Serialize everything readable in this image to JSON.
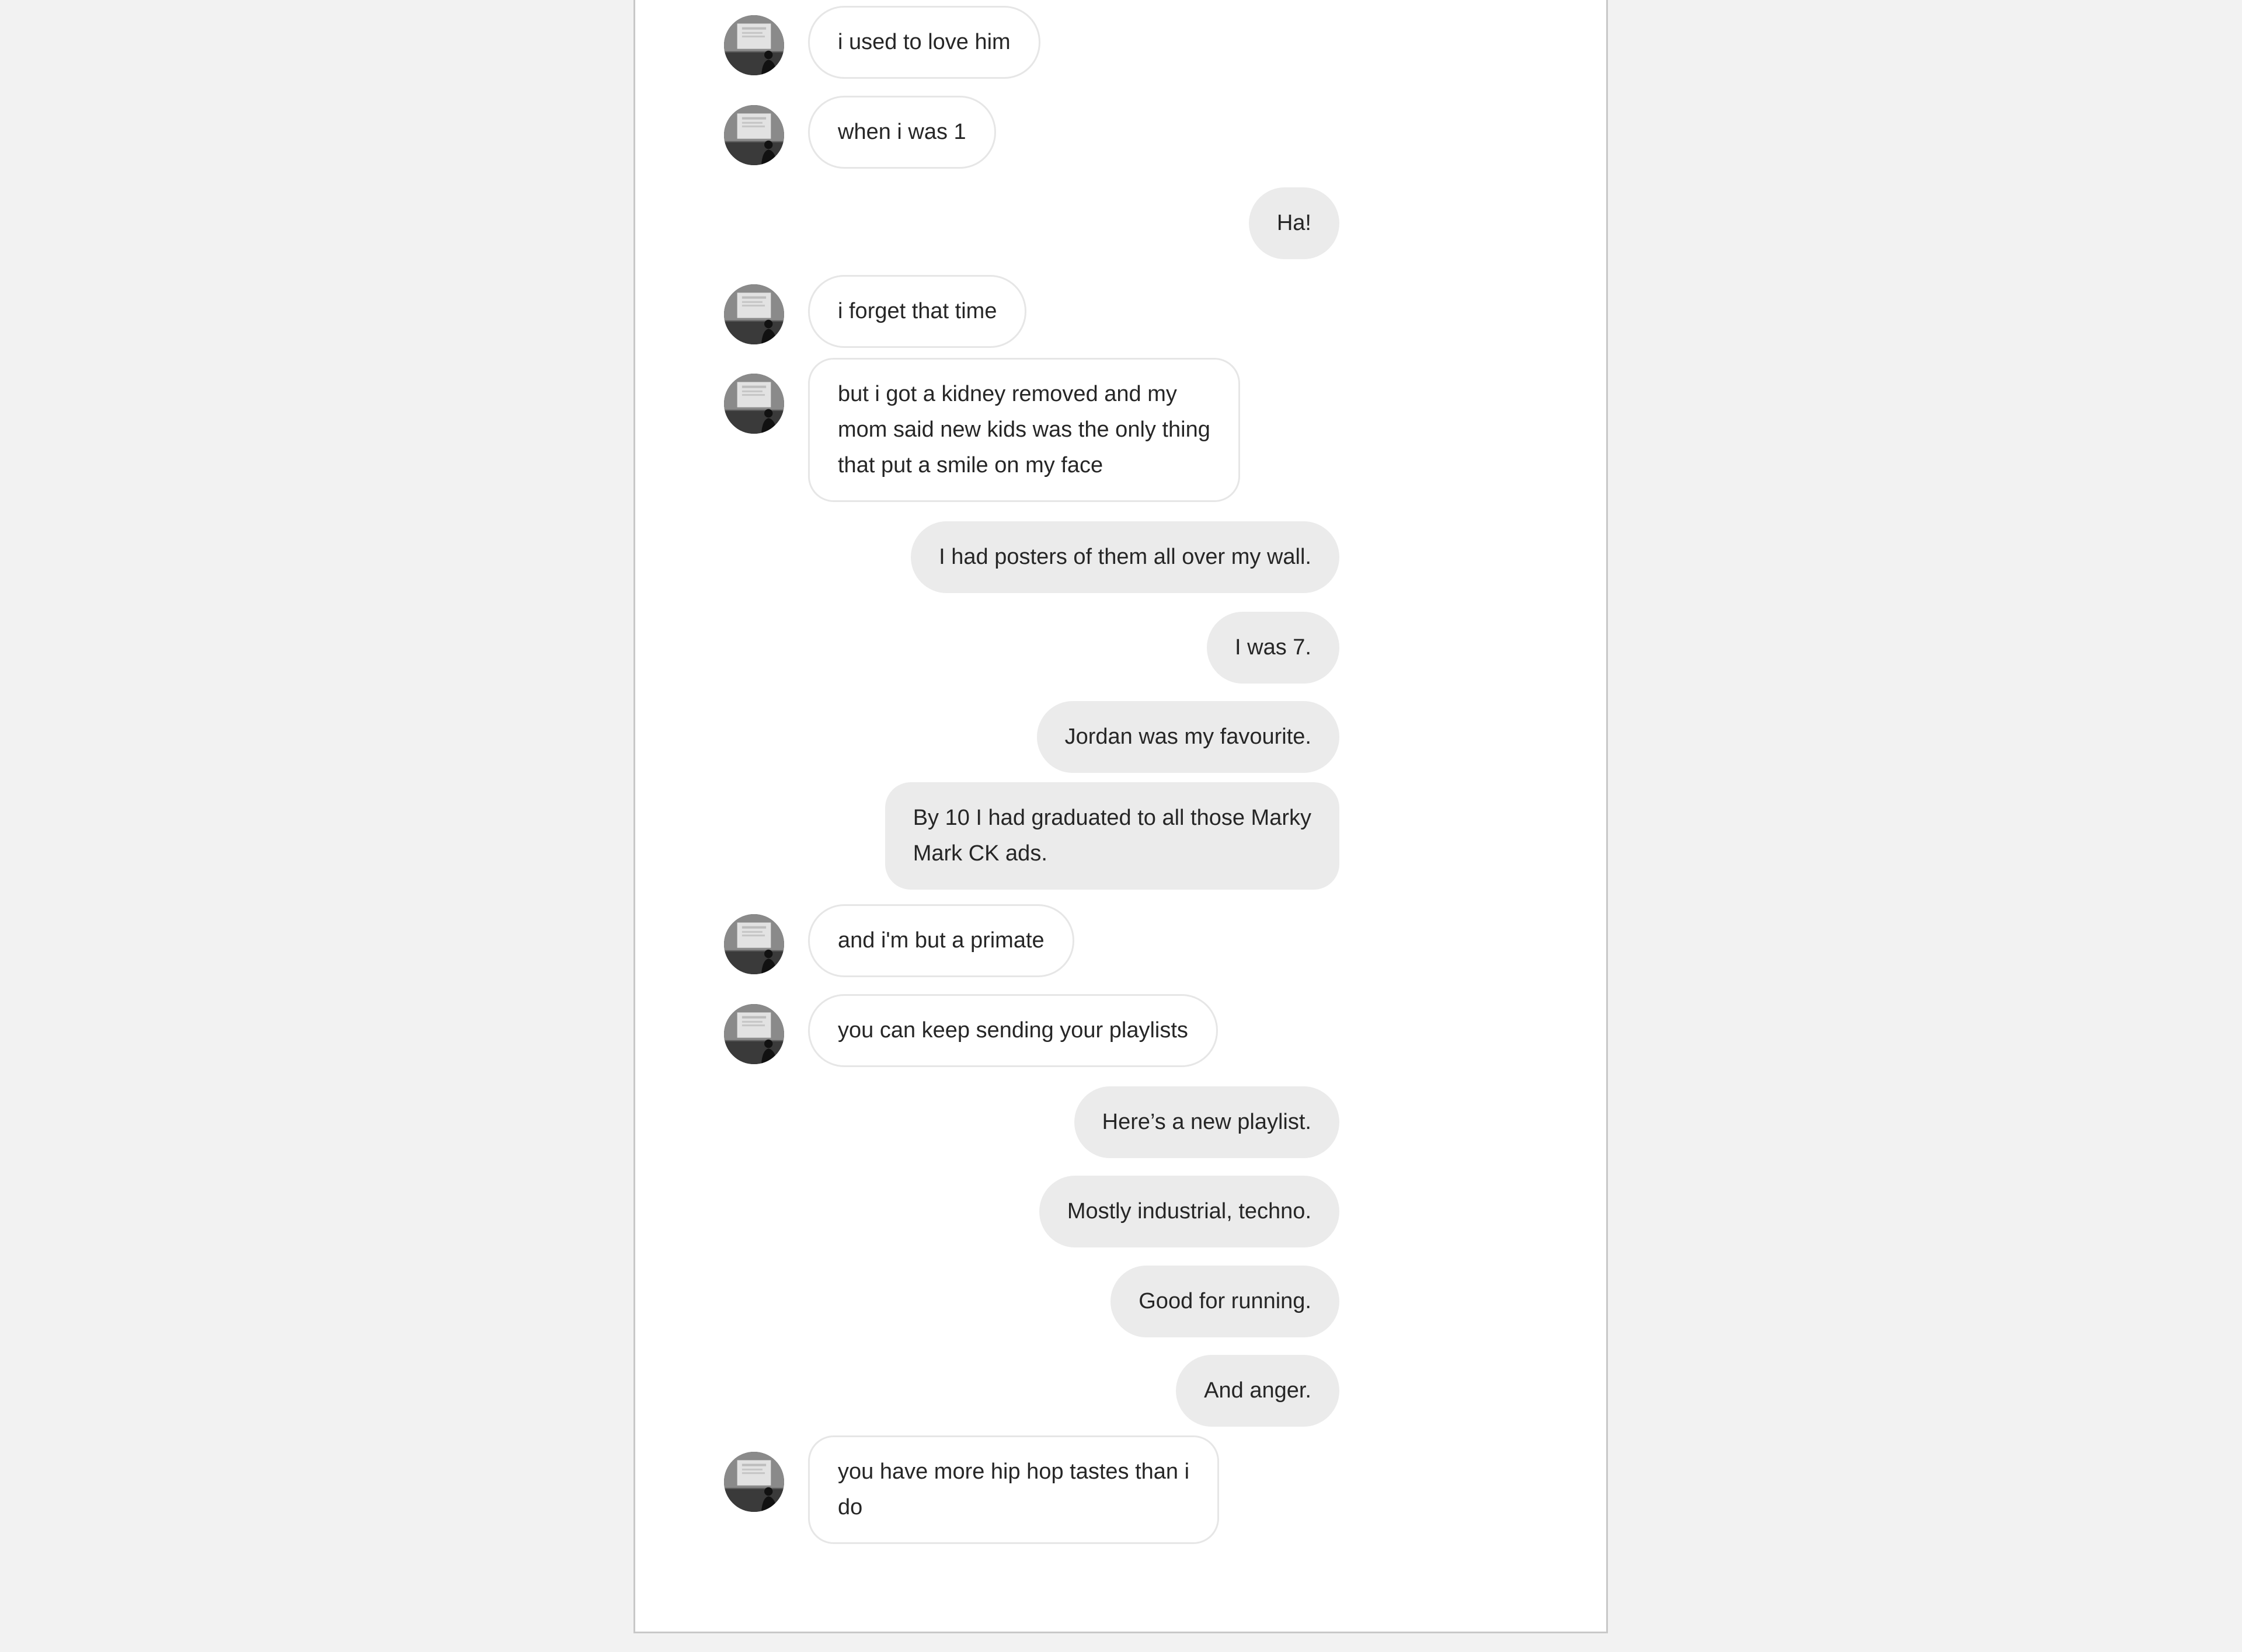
{
  "conversation": {
    "messages": [
      {
        "sender": "them",
        "lines": [
          "i used to love him"
        ]
      },
      {
        "sender": "them",
        "lines": [
          "when i was 1"
        ]
      },
      {
        "sender": "me",
        "lines": [
          "Ha!"
        ]
      },
      {
        "sender": "them",
        "lines": [
          "i forget that time"
        ]
      },
      {
        "sender": "them",
        "lines": [
          "but i got a kidney removed and my",
          "mom said new kids was the only thing",
          "that put a smile on my face"
        ]
      },
      {
        "sender": "me",
        "lines": [
          "I had posters of them all over my wall."
        ]
      },
      {
        "sender": "me",
        "lines": [
          "I was 7."
        ]
      },
      {
        "sender": "me",
        "lines": [
          "Jordan was my favourite."
        ]
      },
      {
        "sender": "me",
        "lines": [
          "By 10 I had graduated to all those Marky",
          "Mark CK ads."
        ]
      },
      {
        "sender": "them",
        "lines": [
          "and i'm but a primate"
        ]
      },
      {
        "sender": "them",
        "lines": [
          "you can keep sending your playlists"
        ]
      },
      {
        "sender": "me",
        "lines": [
          "Here’s a new playlist."
        ]
      },
      {
        "sender": "me",
        "lines": [
          "Mostly industrial, techno."
        ]
      },
      {
        "sender": "me",
        "lines": [
          "Good for running."
        ]
      },
      {
        "sender": "me",
        "lines": [
          "And anger."
        ]
      },
      {
        "sender": "them",
        "lines": [
          "you have more hip hop tastes than i",
          "do"
        ]
      }
    ]
  },
  "icons": {
    "avatar": "profile-photo-icon"
  },
  "colors": {
    "background": "#f2f2f2",
    "panel": "#ffffff",
    "incoming_bubble_border": "#e6e6e6",
    "outgoing_bubble": "#ebebeb",
    "text": "#262626"
  }
}
